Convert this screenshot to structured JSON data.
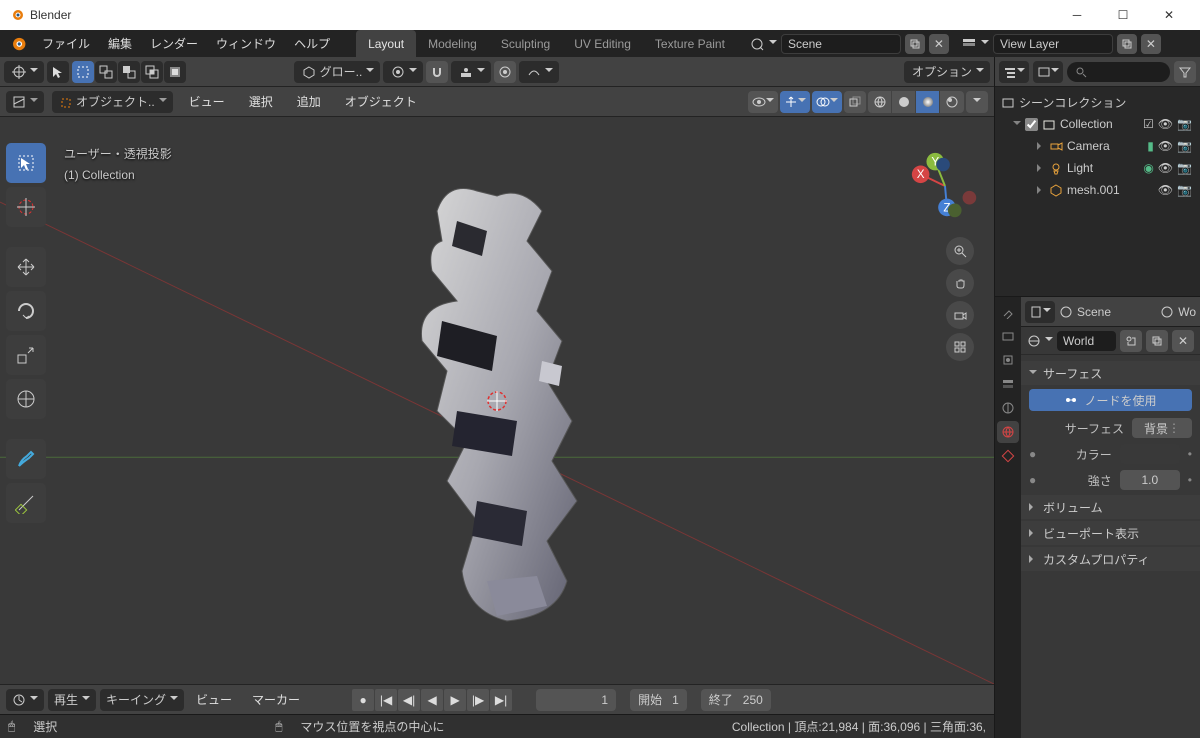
{
  "window": {
    "title": "Blender"
  },
  "menubar": {
    "items": [
      "ファイル",
      "編集",
      "レンダー",
      "ウィンドウ",
      "ヘルプ"
    ]
  },
  "workspaces": {
    "tabs": [
      "Layout",
      "Modeling",
      "Sculpting",
      "UV Editing",
      "Texture Paint"
    ],
    "active": 0
  },
  "scene": {
    "label": "Scene",
    "viewlayer": "View Layer"
  },
  "toolbar3d": {
    "mode": "オブジェクト..",
    "global": "グロー..",
    "options": "オプション"
  },
  "header3d": {
    "menus": [
      "ビュー",
      "選択",
      "追加",
      "オブジェクト"
    ]
  },
  "viewport": {
    "line1": "ユーザー・透視投影",
    "line2": "(1) Collection"
  },
  "timeline": {
    "play": "再生",
    "keying": "キーイング",
    "view": "ビュー",
    "marker": "マーカー",
    "frame": "1",
    "start_label": "開始",
    "start": "1",
    "end_label": "終了",
    "end": "250"
  },
  "status": {
    "mouse_select": "選択",
    "center": "マウス位置を視点の中心に",
    "stats": "Collection | 頂点:21,984 | 面:36,096 | 三角面:36,"
  },
  "outliner": {
    "root": "シーンコレクション",
    "collection": "Collection",
    "items": [
      {
        "name": "Camera",
        "type": "camera"
      },
      {
        "name": "Light",
        "type": "light"
      },
      {
        "name": "mesh.001",
        "type": "mesh"
      }
    ]
  },
  "properties": {
    "scene": "Scene",
    "wo": "Wo",
    "world": "World",
    "surface_header": "サーフェス",
    "use_nodes": "ノードを使用",
    "surface_label": "サーフェス",
    "surface_value": "背景",
    "color_label": "カラー",
    "strength_label": "強さ",
    "strength_value": "1.0",
    "volume": "ボリューム",
    "viewport": "ビューポート表示",
    "custom": "カスタムプロパティ"
  }
}
